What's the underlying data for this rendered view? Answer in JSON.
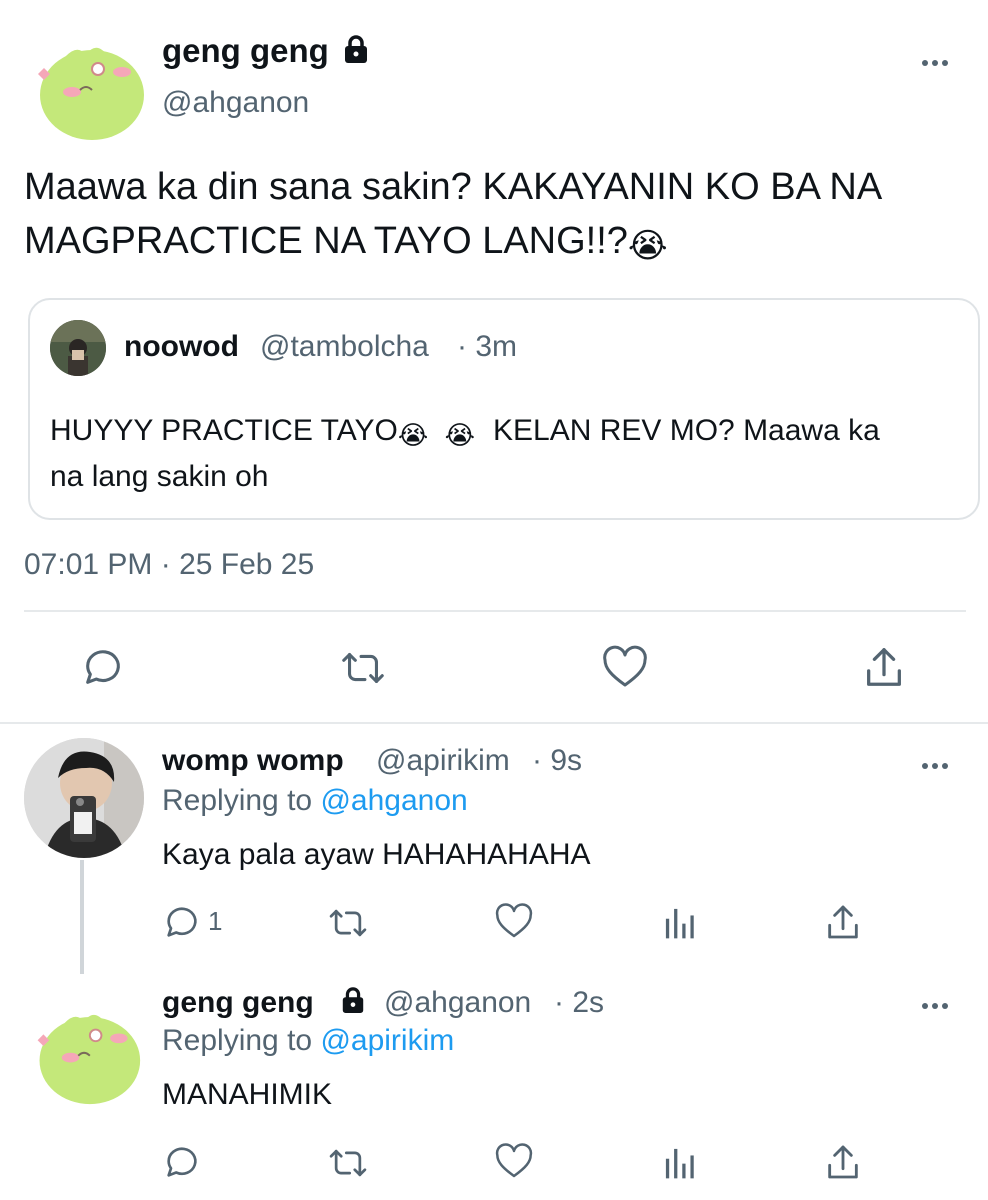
{
  "main_tweet": {
    "display_name": "geng geng",
    "handle": "@ahganon",
    "text": "Maawa ka din sana sakin? KAKAYANIN KO BA NA",
    "text_line2": "MAGPRACTICE NA TAYO LANG!!?",
    "text_emoji": "😭",
    "timestamp": "07:01 PM · 25 Feb 25",
    "quoted": {
      "display_name": "noowod",
      "handle": "@tambolcha",
      "age": "· 3m",
      "text_line1a": "HUYYY PRACTICE TAYO",
      "emoji1": "😭",
      "emoji2": "😭",
      "text_line1b": "KELAN REV MO? Maawa ka",
      "text_line2": "na lang sakin oh"
    }
  },
  "reply1": {
    "display_name": "womp womp",
    "handle": "@apirikim",
    "age": "· 9s",
    "replying_prefix": "Replying to",
    "replying_to": "@ahganon",
    "text": "Kaya pala ayaw HAHAHAHAHA",
    "reply_count": "1"
  },
  "reply2": {
    "display_name": "geng geng",
    "handle": "@ahganon",
    "age": "· 2s",
    "replying_prefix": "Replying to",
    "replying_to": "@apirikim",
    "text": "MANAHIMIK"
  },
  "colors": {
    "accent": "#1d9bf0",
    "muted": "#536471",
    "avatar_green": "#c4e87a",
    "divider": "#e6e9eb"
  }
}
